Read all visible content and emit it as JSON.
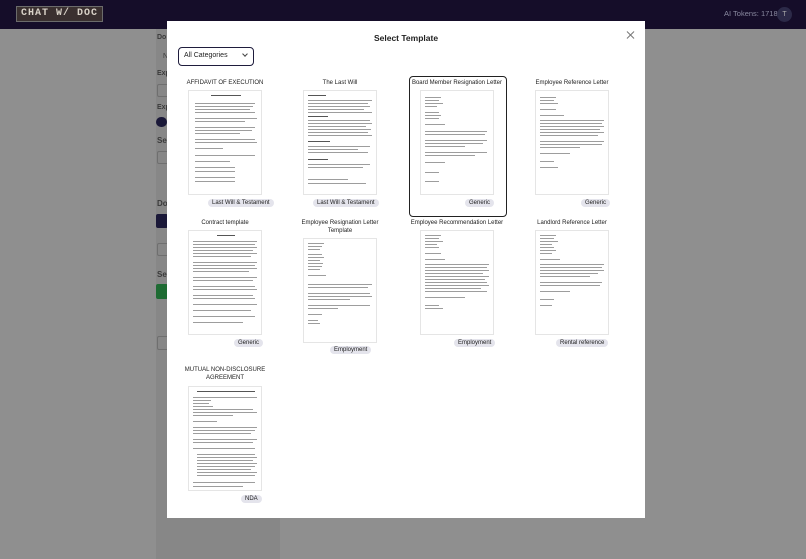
{
  "app": {
    "logo_text": "CHAT W/ DOC",
    "tokens_label": "AI Tokens: 1718",
    "avatar_letter": "T"
  },
  "background": {
    "fragments": [
      "Do",
      "N",
      "Exp",
      "Exp",
      "Se",
      "Do",
      "Se"
    ]
  },
  "modal": {
    "title": "Select Template",
    "category_select": {
      "selected": "All Categories"
    },
    "templates": [
      {
        "title": "AFFIDAVIT OF EXECUTION",
        "category": "Last Will & Testament",
        "selected": false
      },
      {
        "title": "The Last Will",
        "category": "Last Will & Testament",
        "selected": false
      },
      {
        "title": "Board Member Resignation Letter",
        "category": "Generic",
        "selected": true
      },
      {
        "title": "Employee Reference Letter",
        "category": "Generic",
        "selected": false
      },
      {
        "title": "Contract template",
        "category": "Generic",
        "selected": false
      },
      {
        "title": "Employee Resignation Letter Template",
        "category": "Employment",
        "selected": false
      },
      {
        "title": "Employee Recommendation Letter",
        "category": "Employment",
        "selected": false
      },
      {
        "title": "Landlord Reference Letter",
        "category": "Rental reference",
        "selected": false
      },
      {
        "title": "MUTUAL NON-DISCLOSURE AGREEMENT",
        "category": "NDA",
        "selected": false
      }
    ]
  }
}
